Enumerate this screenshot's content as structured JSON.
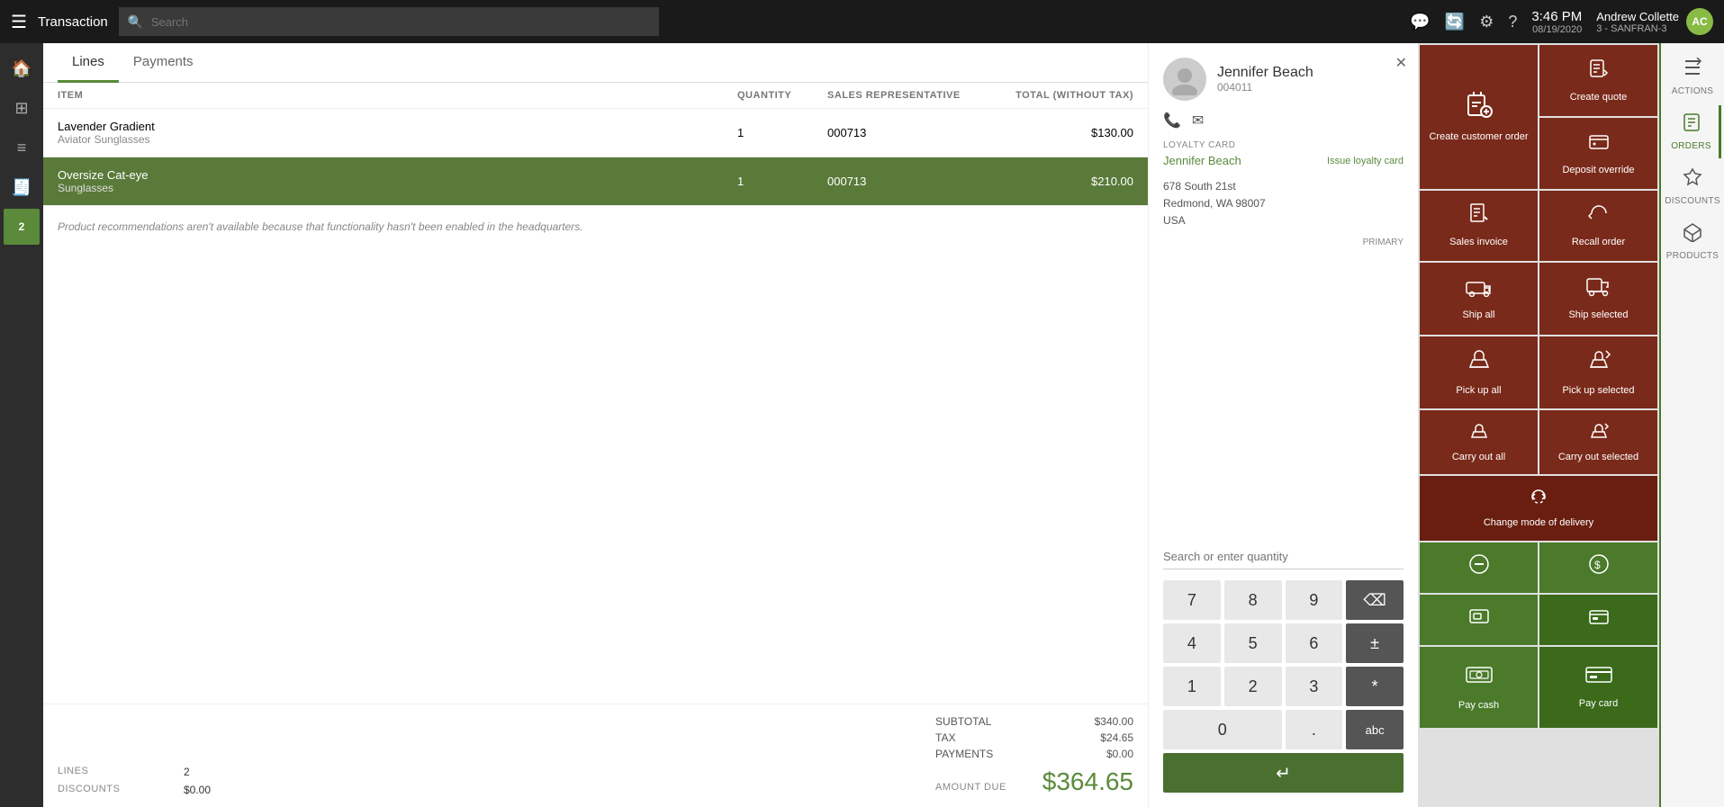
{
  "topbar": {
    "app_title": "Transaction",
    "search_placeholder": "Search",
    "time": "3:46 PM",
    "date": "08/19/2020",
    "user_name": "Andrew Collette",
    "user_subtitle": "3 - SANFRAN-3",
    "avatar_initials": "AC"
  },
  "tabs": [
    {
      "id": "lines",
      "label": "Lines"
    },
    {
      "id": "payments",
      "label": "Payments"
    }
  ],
  "active_tab": "lines",
  "table": {
    "headers": {
      "item": "ITEM",
      "quantity": "QUANTITY",
      "sales_rep": "SALES REPRESENTATIVE",
      "total": "TOTAL (WITHOUT TAX)"
    },
    "rows": [
      {
        "name": "Lavender Gradient Aviator Sunglasses",
        "quantity": "1",
        "sales_rep": "000713",
        "total": "$130.00",
        "selected": false
      },
      {
        "name": "Oversize Cat-eye Sunglasses",
        "quantity": "1",
        "sales_rep": "000713",
        "total": "$210.00",
        "selected": true
      }
    ]
  },
  "recommendation_text": "Product recommendations aren't available because that functionality hasn't been enabled in the headquarters.",
  "footer": {
    "lines_label": "LINES",
    "lines_value": "2",
    "discounts_label": "DISCOUNTS",
    "discounts_value": "$0.00",
    "subtotal_label": "SUBTOTAL",
    "subtotal_value": "$340.00",
    "tax_label": "TAX",
    "tax_value": "$24.65",
    "payments_label": "PAYMENTS",
    "payments_value": "$0.00",
    "amount_due_label": "AMOUNT DUE",
    "amount_due_value": "$364.65"
  },
  "customer": {
    "name": "Jennifer Beach",
    "id": "004011",
    "loyalty_label": "LOYALTY CARD",
    "loyalty_name": "Jennifer Beach",
    "issue_loyalty_label": "Issue loyalty card",
    "address_line1": "678 South 21st",
    "address_line2": "Redmond, WA 98007",
    "address_line3": "USA",
    "primary_label": "PRIMARY"
  },
  "numpad": {
    "search_placeholder": "Search or enter quantity",
    "keys": [
      "7",
      "8",
      "9",
      "⌫",
      "4",
      "5",
      "6",
      "±",
      "1",
      "2",
      "3",
      "*",
      "0",
      ".",
      "abc",
      "↵"
    ]
  },
  "actions_sidebar": {
    "items": [
      {
        "id": "actions",
        "icon": "⚡",
        "label": "ACTIONS"
      },
      {
        "id": "orders",
        "icon": "📋",
        "label": "ORDERS"
      },
      {
        "id": "discounts",
        "icon": "🏷",
        "label": "DISCOUNTS"
      },
      {
        "id": "products",
        "icon": "📦",
        "label": "PRODUCTS"
      }
    ]
  },
  "tiles": {
    "row1": [
      {
        "id": "create-customer-order",
        "label": "Create customer order",
        "icon": "📋"
      },
      {
        "id": "create-quote",
        "label": "Create quote",
        "icon": "📄"
      },
      {
        "id": "deposit-override",
        "label": "Deposit override",
        "icon": "💰"
      }
    ],
    "row2": [
      {
        "id": "sales-invoice",
        "label": "Sales invoice",
        "icon": "🧾"
      },
      {
        "id": "recall-order",
        "label": "Recall order",
        "icon": "↩"
      }
    ],
    "ship_all": {
      "label": "Ship all",
      "icon": "🚚"
    },
    "ship_selected": {
      "label": "Ship selected",
      "icon": "📦"
    },
    "pick_up_all": {
      "label": "Pick up all",
      "icon": "🛍"
    },
    "pick_up_selected": {
      "label": "Pick up selected",
      "icon": "🛒"
    },
    "carry_out_all": {
      "label": "Carry out all",
      "icon": "🛒"
    },
    "carry_out_selected": {
      "label": "Carry out selected",
      "icon": "🛒"
    },
    "change_mode_delivery": {
      "label": "Change mode of delivery",
      "icon": "🔄"
    },
    "icon1": {
      "label": "",
      "icon": "⊖"
    },
    "icon2": {
      "label": "",
      "icon": "💲"
    },
    "icon3": {
      "label": "",
      "icon": "🖼"
    },
    "icon4": {
      "label": "",
      "icon": "💳"
    },
    "pay_cash": {
      "label": "Pay cash",
      "icon": "💵"
    },
    "pay_card": {
      "label": "Pay card",
      "icon": "💳"
    }
  }
}
